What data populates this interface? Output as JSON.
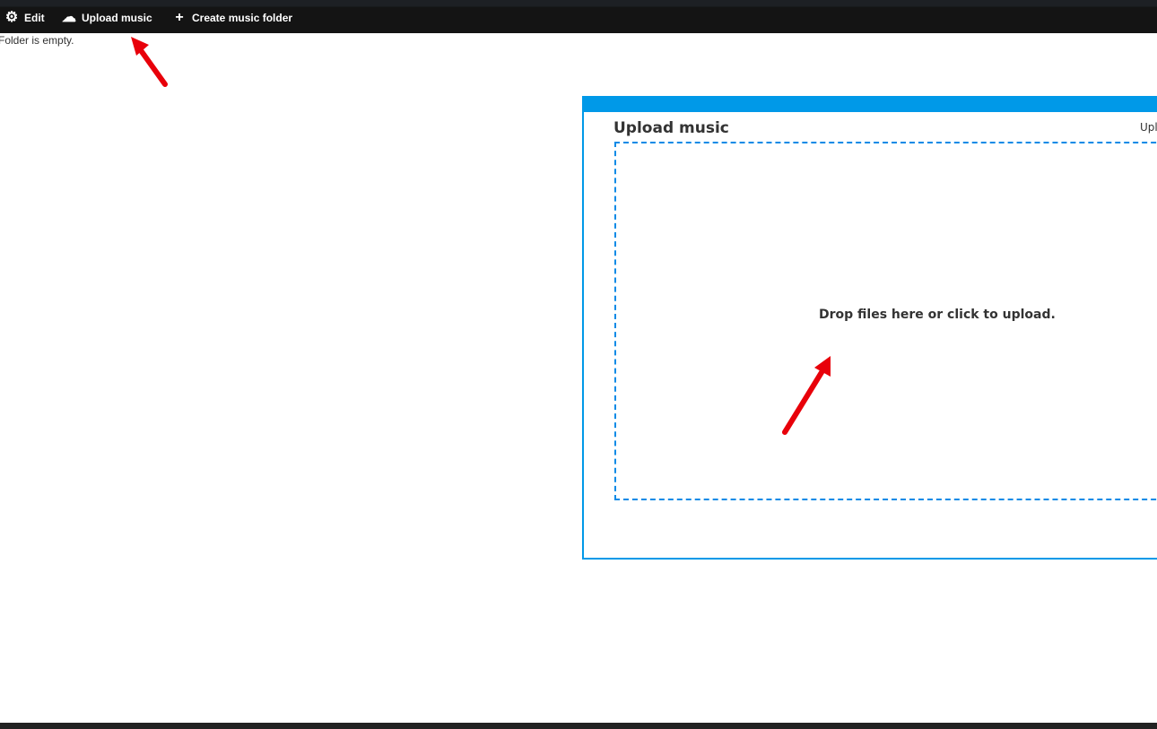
{
  "toolbar": {
    "items": [
      {
        "label": "Edit",
        "icon": "gear-icon"
      },
      {
        "label": "Upload music",
        "icon": "cloud-upload-icon"
      },
      {
        "label": "Create music folder",
        "icon": "plus-icon"
      }
    ]
  },
  "folder": {
    "status": "Folder is empty."
  },
  "upload_panel": {
    "title": "Upload music",
    "right_text": "Upl",
    "drop_text": "Drop files here or click to upload.",
    "accent": "#0099e8"
  },
  "annotations": {
    "arrow_color": "#e8000a"
  }
}
